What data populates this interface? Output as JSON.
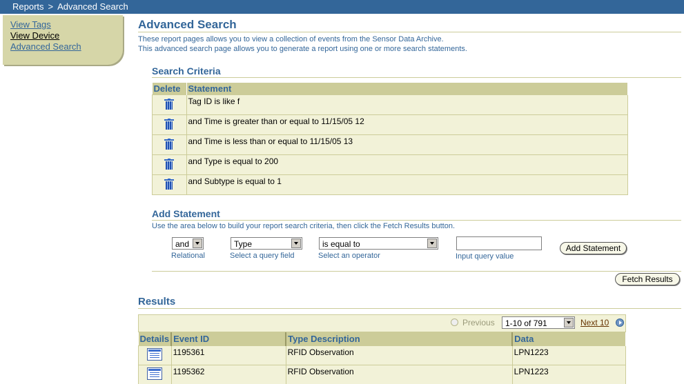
{
  "breadcrumb": {
    "root": "Reports",
    "separator": ">",
    "current": "Advanced Search"
  },
  "sidenav": {
    "items": [
      {
        "label": "View Tags"
      },
      {
        "label": "View Device"
      },
      {
        "label": "Advanced Search"
      }
    ]
  },
  "page": {
    "title": "Advanced Search",
    "intro_line1": "These report pages allows you to view a collection of events from the Sensor Data Archive.",
    "intro_line2": "This advanced search page allows you to generate a report using one or more search statements."
  },
  "criteria": {
    "heading": "Search Criteria",
    "col_delete": "Delete",
    "col_statement": "Statement",
    "rows": [
      "Tag ID is like f",
      "and Time is greater than or equal to 11/15/05 12",
      "and Time is less than or equal to 11/15/05 13",
      "and Type is equal to 200",
      "and Subtype is equal to 1"
    ]
  },
  "add_statement": {
    "heading": "Add Statement",
    "help": "Use the area below to build your report search criteria, then click the Fetch Results button.",
    "relational_value": "and",
    "relational_label": "Relational",
    "field_value": "Type",
    "field_label": "Select a query field",
    "operator_value": "is equal to",
    "operator_label": "Select an operator",
    "input_value": "",
    "input_label": "Input query value",
    "add_button": "Add Statement",
    "fetch_button": "Fetch Results"
  },
  "results": {
    "heading": "Results",
    "previous": "Previous",
    "range": "1-10 of 791",
    "next": "Next 10",
    "columns": [
      "Details",
      "Event ID",
      "Type Description",
      "Data"
    ],
    "rows": [
      {
        "event_id": "1195361",
        "type": "RFID Observation",
        "data": "LPN1223"
      },
      {
        "event_id": "1195362",
        "type": "RFID Observation",
        "data": "LPN1223"
      }
    ]
  },
  "colors": {
    "header_blue": "#336699",
    "khaki": "#cccc99",
    "row_bg": "#f2f2d8"
  }
}
